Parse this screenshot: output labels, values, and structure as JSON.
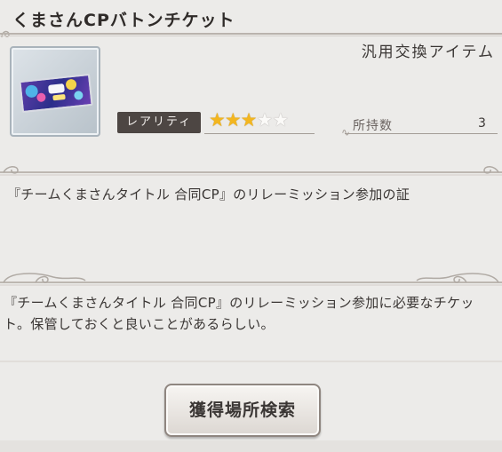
{
  "item": {
    "name": "くまさんCPバトンチケット",
    "category": "汎用交換アイテム",
    "rarity_label": "レアリティ",
    "rarity": {
      "value": 3,
      "max": 5
    },
    "held_label": "所持数",
    "held_count": "3"
  },
  "description": {
    "short": "『チームくまさんタイトル 合同CP』のリレーミッション参加の証",
    "long": "『チームくまさんタイトル 合同CP』のリレーミッション参加に必要なチケット。保管しておくと良いことがあるらしい。"
  },
  "actions": {
    "search_button": "獲得場所検索"
  },
  "colors": {
    "background": "#ecebe9",
    "star_on": "#f3b61f",
    "badge_bg": "#4d4643"
  }
}
